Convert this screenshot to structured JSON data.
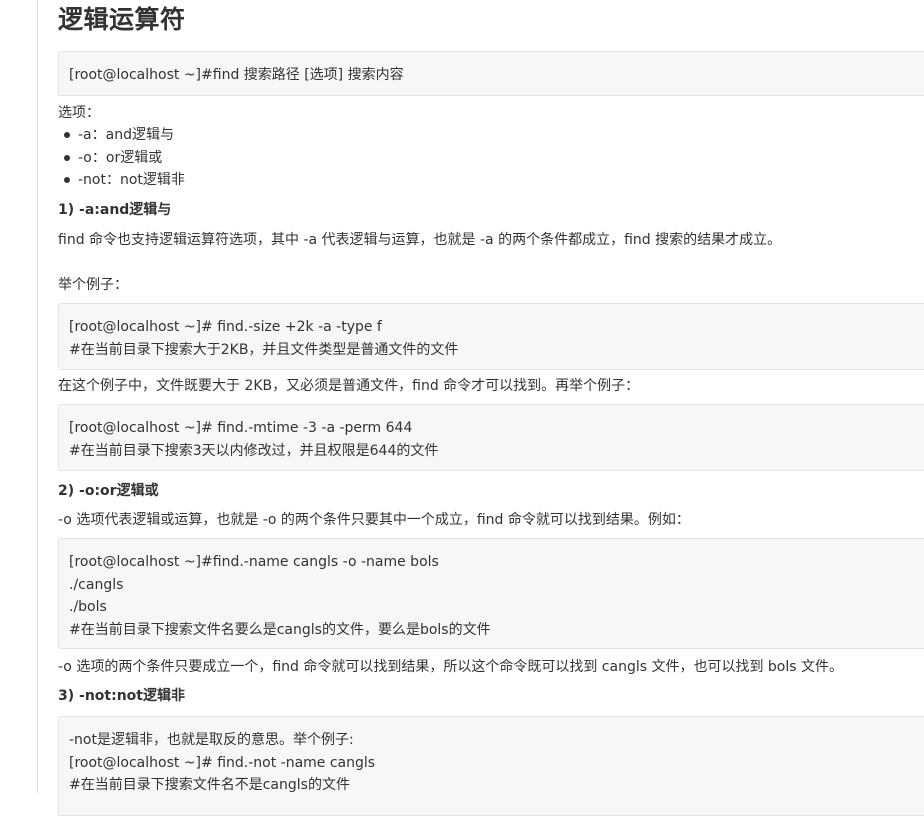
{
  "title": "逻辑运算符",
  "syntax_code": [
    "[root@localhost ~]#find 搜索路径 [选项] 搜索内容"
  ],
  "options_label": "选项：",
  "options": [
    "-a：and逻辑与",
    "-o：or逻辑或",
    "-not：not逻辑非"
  ],
  "section1": {
    "heading": "1) -a:and逻辑与",
    "desc": "find 命令也支持逻辑运算符选项，其中 -a 代表逻辑与运算，也就是 -a 的两个条件都成立，find 搜索的结果才成立。",
    "example_label": "举个例子：",
    "code1": [
      "[root@localhost ~]# find.-size +2k -a -type f",
      "#在当前目录下搜索大于2KB，并且文件类型是普通文件的文件"
    ],
    "between": "在这个例子中，文件既要大于 2KB，又必须是普通文件，find 命令才可以找到。再举个例子：",
    "code2": [
      "[root@localhost ~]# find.-mtime -3 -a -perm 644",
      "#在当前目录下搜索3天以内修改过，并且权限是644的文件"
    ]
  },
  "section2": {
    "heading": "2) -o:or逻辑或",
    "desc": "-o 选项代表逻辑或运算，也就是 -o 的两个条件只要其中一个成立，find 命令就可以找到结果。例如：",
    "code": [
      "[root@localhost ~]#find.-name cangls -o -name bols",
      "./cangls",
      "./bols",
      "#在当前目录下搜索文件名要么是cangls的文件，要么是bols的文件"
    ],
    "after": "-o 选项的两个条件只要成立一个，find 命令就可以找到结果，所以这个命令既可以找到 cangls 文件，也可以找到 bols 文件。"
  },
  "section3": {
    "heading": "3) -not:not逻辑非",
    "code": [
      "-not是逻辑非，也就是取反的意思。举个例子:",
      "[root@localhost ~]# find.-not -name cangls",
      "#在当前目录下搜索文件名不是cangls的文件"
    ]
  }
}
